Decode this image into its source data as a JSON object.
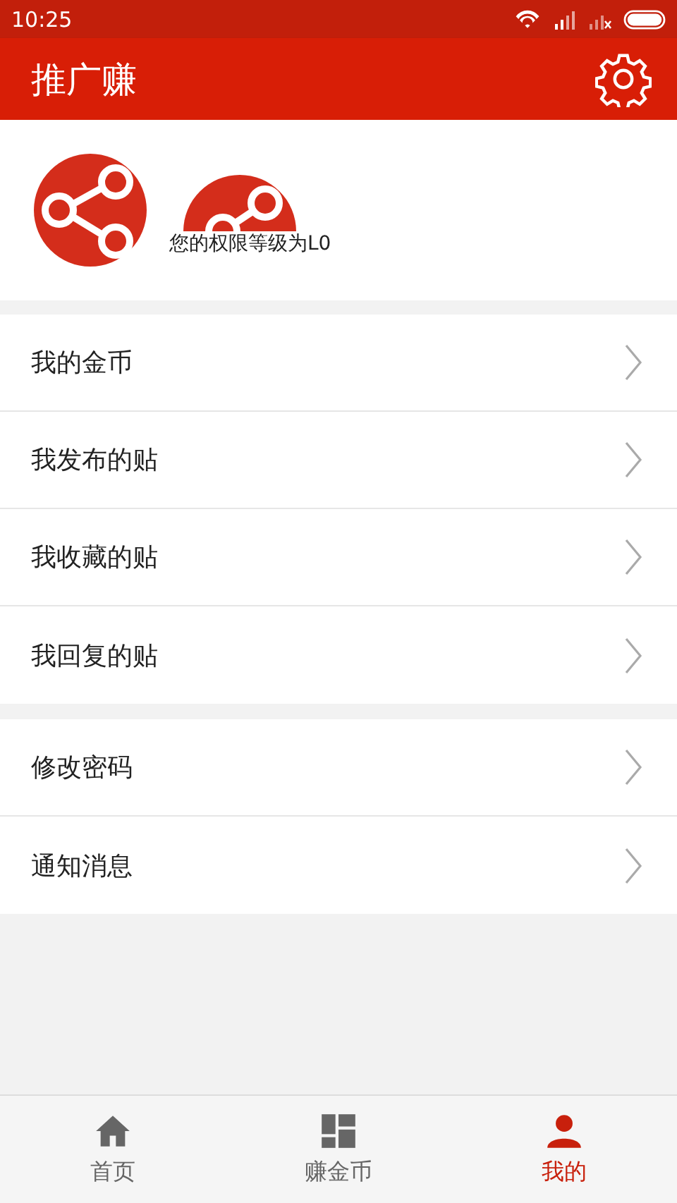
{
  "status_bar": {
    "time": "10:25"
  },
  "app_bar": {
    "title": "推广赚"
  },
  "profile": {
    "level_text": "您的权限等级为L0"
  },
  "menu_groups": [
    {
      "items": [
        {
          "label": "我的金币"
        },
        {
          "label": "我发布的贴"
        },
        {
          "label": "我收藏的贴"
        },
        {
          "label": "我回复的贴"
        }
      ]
    },
    {
      "items": [
        {
          "label": "修改密码"
        },
        {
          "label": "通知消息"
        }
      ]
    }
  ],
  "tabs": [
    {
      "label": "首页",
      "kind": "home",
      "selected": false
    },
    {
      "label": "赚金币",
      "kind": "grid",
      "selected": false
    },
    {
      "label": "我的",
      "kind": "person",
      "selected": true
    }
  ]
}
